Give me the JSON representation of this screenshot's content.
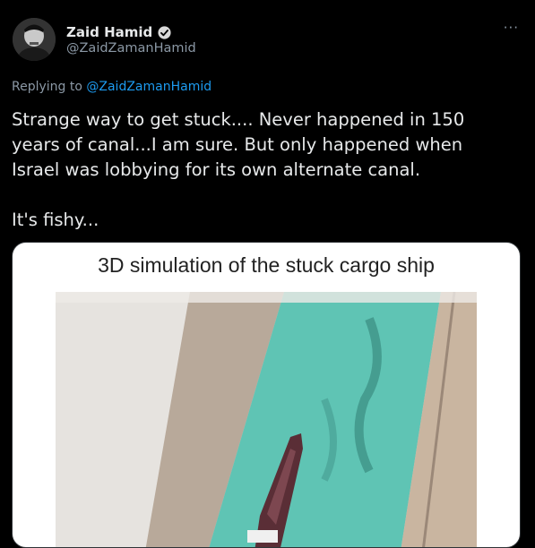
{
  "author": {
    "display_name": "Zaid Hamid",
    "handle": "@ZaidZamanHamid",
    "verified": true
  },
  "more_icon": "···",
  "reply": {
    "prefix": "Replying to ",
    "mention": "@ZaidZamanHamid"
  },
  "tweet_text": "Strange way to get stuck.... Never happened in 150 years of canal...I am sure. But only happened when Israel was lobbying for its own alternate canal.\n\nIt's fishy...",
  "media": {
    "caption": "3D simulation of the stuck cargo ship"
  },
  "colors": {
    "background": "#000000",
    "link": "#1d9bf0",
    "secondary_text": "#8b98a5",
    "canal_water": "#5fc4b4",
    "bank_sand": "#b9aa9a",
    "ship_hull": "#5a2e36"
  },
  "icons": [
    "avatar",
    "verified-badge-icon",
    "more-options-icon"
  ]
}
